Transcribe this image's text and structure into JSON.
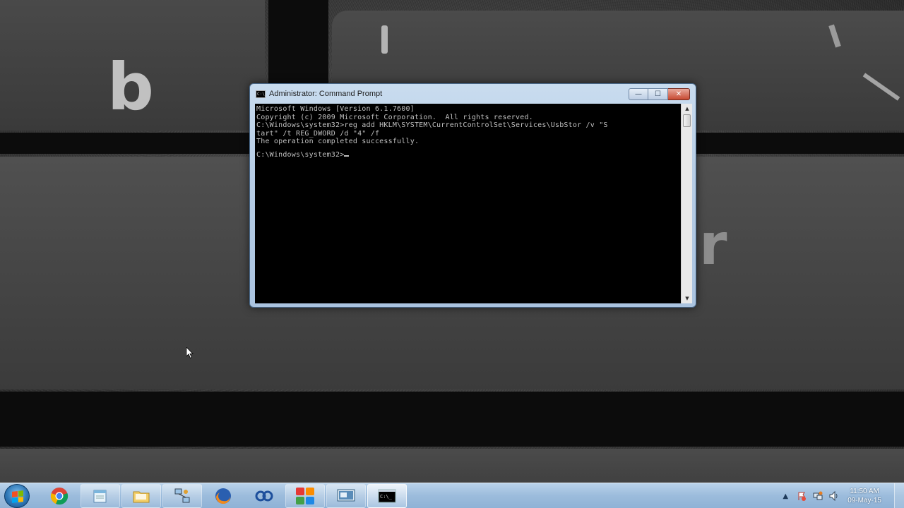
{
  "window": {
    "title": "Administrator: Command Prompt",
    "icon_text": "C:\\_",
    "controls": {
      "minimize_glyph": "—",
      "maximize_glyph": "☐",
      "close_glyph": "✕"
    }
  },
  "console": {
    "lines": [
      "Microsoft Windows [Version 6.1.7600]",
      "Copyright (c) 2009 Microsoft Corporation.  All rights reserved.",
      "",
      "C:\\Windows\\system32>reg add HKLM\\SYSTEM\\CurrentControlSet\\Services\\UsbStor /v \"S",
      "tart\" /t REG_DWORD /d \"4\" /f",
      "The operation completed successfully.",
      "",
      "C:\\Windows\\system32>"
    ]
  },
  "wallpaper": {
    "key_letters": [
      "b",
      "r"
    ]
  },
  "taskbar": {
    "pinned": [
      {
        "name": "windows-explorer-icon",
        "active": false
      },
      {
        "name": "chrome-icon",
        "active": false
      },
      {
        "name": "notepad-icon",
        "active": false
      },
      {
        "name": "folder-icon",
        "active": false
      },
      {
        "name": "network-tool-icon",
        "active": false
      },
      {
        "name": "firefox-icon",
        "active": false
      },
      {
        "name": "teamviewer-icon",
        "active": false
      },
      {
        "name": "colorful-apps-icon",
        "active": false
      },
      {
        "name": "screenshot-tool-icon",
        "active": false
      },
      {
        "name": "command-prompt-icon",
        "active": true
      }
    ],
    "tray": {
      "time": "11:50 AM",
      "date": "09-May-15"
    }
  },
  "colors": {
    "console_bg": "#000000",
    "console_text": "#c0c0c0",
    "taskbar": "#9cbcdc",
    "close_button": "#c74a32"
  }
}
